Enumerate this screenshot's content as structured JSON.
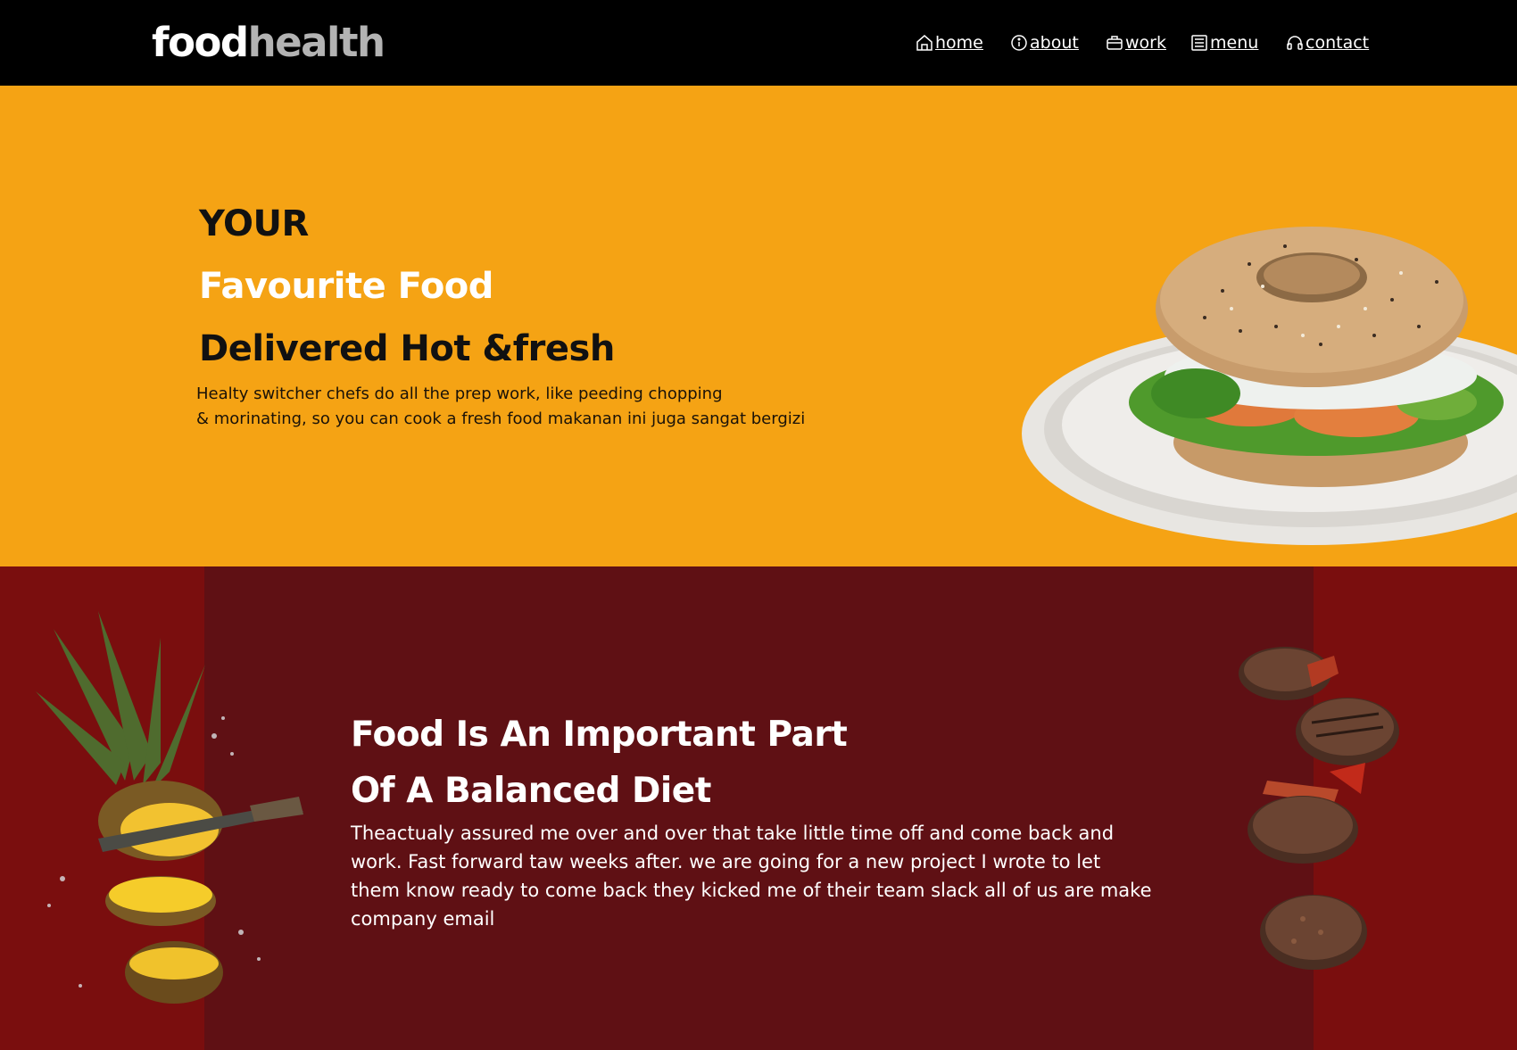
{
  "header": {
    "logo_first": "food",
    "logo_second": "health",
    "nav": [
      {
        "label": "home",
        "icon": "home-icon"
      },
      {
        "label": "about",
        "icon": "info-icon"
      },
      {
        "label": "work",
        "icon": "briefcase-icon"
      },
      {
        "label": "menu",
        "icon": "list-icon"
      },
      {
        "label": "contact",
        "icon": "headset-icon"
      }
    ]
  },
  "hero": {
    "line1": "YOUR",
    "line2": "Favourite Food",
    "line3": "Delivered Hot &fresh",
    "desc_line1": "Healty switcher chefs do all the prep work, like peeding chopping",
    "desc_line2": "& morinating, so you can cook a fresh food makanan ini juga sangat bergizi",
    "image": "bagel-sandwich-image"
  },
  "diet": {
    "title1": "Food Is An Important Part",
    "title2": "Of A Balanced Diet",
    "body": "Theactualy assured me over and over that take little time off and come back and work. Fast forward taw weeks after. we are going for a new project I wrote to let them know ready to come back they kicked me of their team slack all of us are make company email",
    "left_image": "pineapple-image",
    "right_image": "steak-patties-image"
  },
  "colors": {
    "header_bg": "#000000",
    "hero_bg": "#f5a314",
    "diet_outer_bg": "#7a0e0e",
    "diet_inner_bg": "#5f1014",
    "logo_accent": "#b3b3b3"
  }
}
